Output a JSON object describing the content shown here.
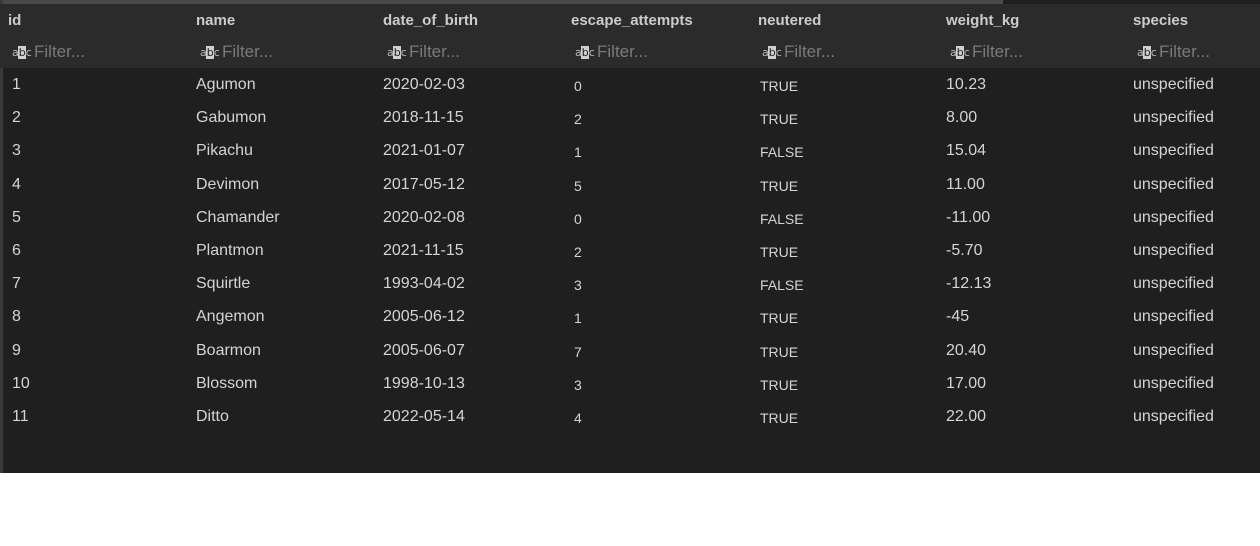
{
  "grid": {
    "columns": [
      "id",
      "name",
      "date_of_birth",
      "escape_attempts",
      "neutered",
      "weight_kg",
      "species"
    ],
    "filter_placeholder": "Filter...",
    "filter_icon_glyph": "abc",
    "rows": [
      [
        "1",
        "Agumon",
        "2020-02-03",
        "0",
        "TRUE",
        "10.23",
        "unspecified"
      ],
      [
        "2",
        "Gabumon",
        "2018-11-15",
        "2",
        "TRUE",
        "8.00",
        "unspecified"
      ],
      [
        "3",
        "Pikachu",
        "2021-01-07",
        "1",
        "FALSE",
        "15.04",
        "unspecified"
      ],
      [
        "4",
        "Devimon",
        "2017-05-12",
        "5",
        "TRUE",
        "11.00",
        "unspecified"
      ],
      [
        "5",
        "Chamander",
        "2020-02-08",
        "0",
        "FALSE",
        "-11.00",
        "unspecified"
      ],
      [
        "6",
        "Plantmon",
        "2021-11-15",
        "2",
        "TRUE",
        "-5.70",
        "unspecified"
      ],
      [
        "7",
        "Squirtle",
        "1993-04-02",
        "3",
        "FALSE",
        "-12.13",
        "unspecified"
      ],
      [
        "8",
        "Angemon",
        "2005-06-12",
        "1",
        "TRUE",
        "-45",
        "unspecified"
      ],
      [
        "9",
        "Boarmon",
        "2005-06-07",
        "7",
        "TRUE",
        "20.40",
        "unspecified"
      ],
      [
        "10",
        "Blossom",
        "1998-10-13",
        "3",
        "TRUE",
        "17.00",
        "unspecified"
      ],
      [
        "11",
        "Ditto",
        "2022-05-14",
        "4",
        "TRUE",
        "22.00",
        "unspecified"
      ]
    ]
  }
}
